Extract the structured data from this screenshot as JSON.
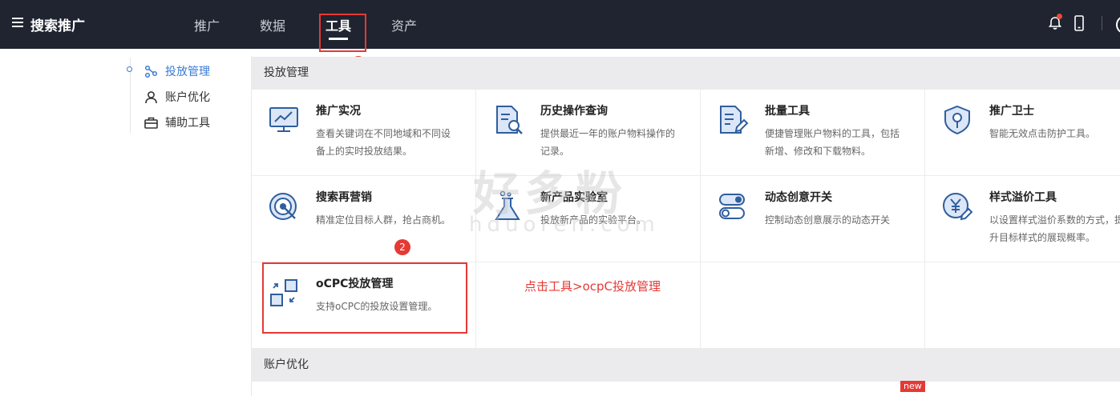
{
  "topbar": {
    "brand": "搜索推广",
    "nav": [
      "推广",
      "数据",
      "工具",
      "资产"
    ],
    "active_nav": "工具",
    "icons": [
      "menu-icon",
      "bell-icon",
      "phone-icon"
    ]
  },
  "sidebar": {
    "items": [
      {
        "label": "投放管理",
        "icon": "share-nodes-icon",
        "active": true
      },
      {
        "label": "账户优化",
        "icon": "user-icon",
        "active": false
      },
      {
        "label": "辅助工具",
        "icon": "toolbox-icon",
        "active": false
      }
    ]
  },
  "sections": [
    {
      "title": "投放管理"
    },
    {
      "title": "账户优化"
    }
  ],
  "cards": [
    {
      "title": "推广实况",
      "desc": "查看关键词在不同地域和不同设备上的实时投放结果。",
      "icon": "monitor-chart-icon"
    },
    {
      "title": "历史操作查询",
      "desc": "提供最近一年的账户物料操作的记录。",
      "icon": "document-search-icon"
    },
    {
      "title": "批量工具",
      "desc": "便捷管理账户物料的工具，包括新增、修改和下载物料。",
      "icon": "document-edit-icon"
    },
    {
      "title": "推广卫士",
      "desc": "智能无效点击防护工具。",
      "icon": "shield-icon"
    },
    {
      "title": "搜索再营销",
      "desc": "精准定位目标人群，抢占商机。",
      "icon": "target-icon"
    },
    {
      "title": "新产品实验室",
      "desc": "投放新产品的实验平台。",
      "icon": "flask-icon"
    },
    {
      "title": "动态创意开关",
      "desc": "控制动态创意展示的动态开关",
      "icon": "toggle-icon"
    },
    {
      "title": "样式溢价工具",
      "desc": "以设置样式溢价系数的方式，提升目标样式的展现概率。",
      "icon": "yen-edit-icon"
    },
    {
      "title": "oCPC投放管理",
      "desc": "支持oCPC的投放设置管理。",
      "icon": "ocpc-icon"
    }
  ],
  "annotations": {
    "step1": "1",
    "step2": "2",
    "instruction": "点击工具>ocpC投放管理"
  },
  "badge": "new",
  "watermark": {
    "main": "好多粉",
    "sub": "hduoren.com"
  },
  "colors": {
    "topbar": "#1f2430",
    "accent": "#3a7bd5",
    "annotation": "#e53935",
    "section_bg": "#ebebed"
  }
}
